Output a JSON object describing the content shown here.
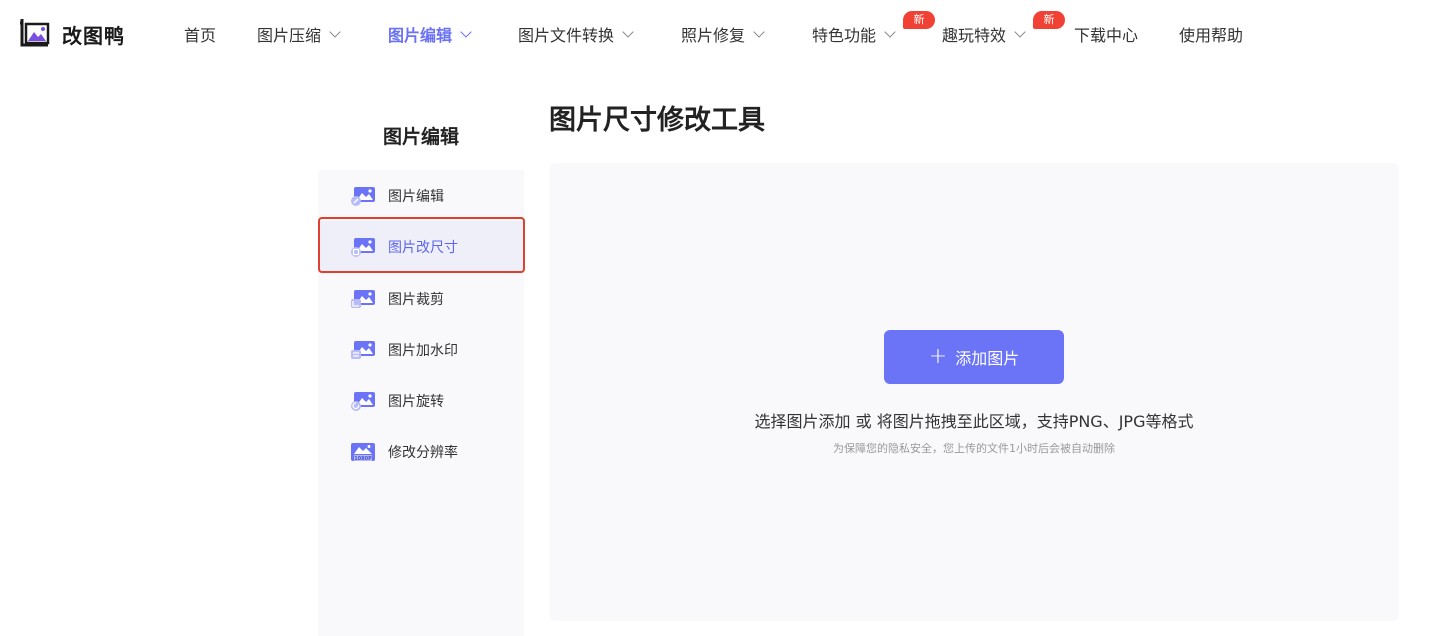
{
  "brand": {
    "name": "改图鸭",
    "accent": "#6a72f5"
  },
  "nav": {
    "items": [
      {
        "label": "首页"
      },
      {
        "label": "图片压缩"
      },
      {
        "label": "图片编辑"
      },
      {
        "label": "图片文件转换"
      },
      {
        "label": "照片修复"
      },
      {
        "label": "特色功能"
      },
      {
        "label": "趣玩特效"
      },
      {
        "label": "下载中心"
      },
      {
        "label": "使用帮助"
      }
    ],
    "badge_new": "新",
    "active_index": 2
  },
  "sidebar": {
    "title": "图片编辑",
    "items": [
      {
        "label": "图片编辑",
        "icon": "image-edit-icon"
      },
      {
        "label": "图片改尺寸",
        "icon": "image-resize-icon"
      },
      {
        "label": "图片裁剪",
        "icon": "image-crop-icon"
      },
      {
        "label": "图片加水印",
        "icon": "image-watermark-icon"
      },
      {
        "label": "图片旋转",
        "icon": "image-rotate-icon"
      },
      {
        "label": "修改分辨率",
        "icon": "image-resolution-icon"
      }
    ],
    "resolution_icon_text": "1080P",
    "active_index": 1
  },
  "main": {
    "title": "图片尺寸修改工具",
    "add_button": "添加图片",
    "hint": "选择图片添加 或 将图片拖拽至此区域，支持PNG、JPG等格式",
    "privacy_note": "为保障您的隐私安全，您上传的文件1小时后会被自动删除"
  }
}
